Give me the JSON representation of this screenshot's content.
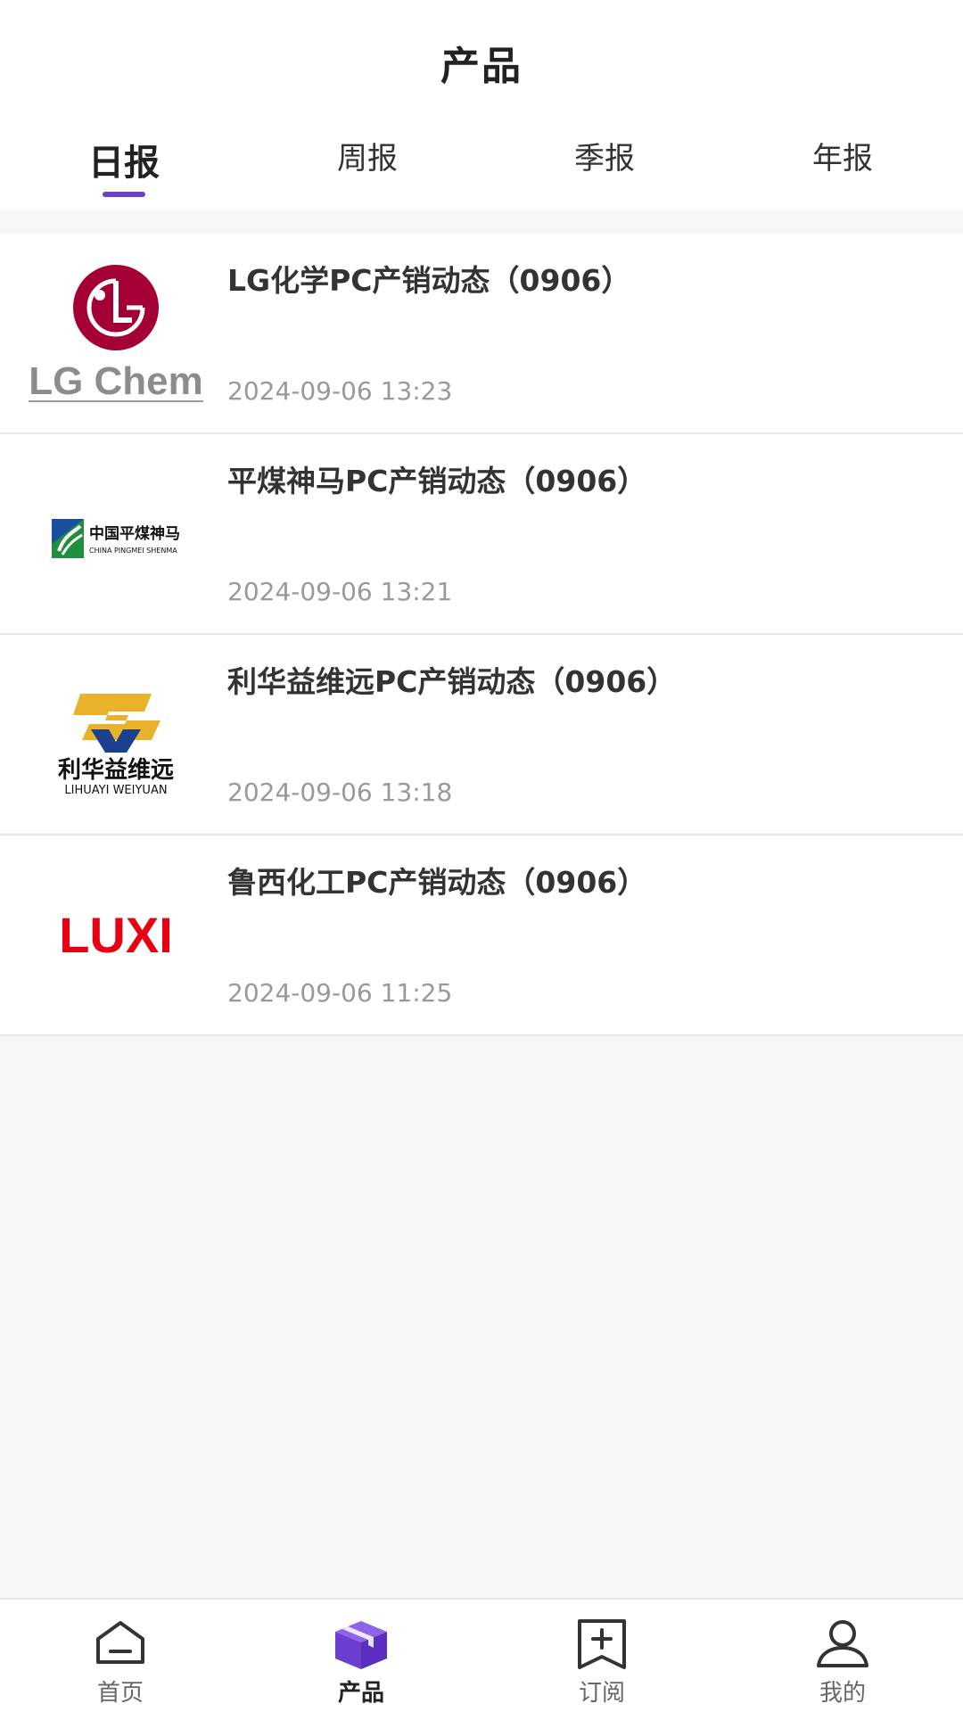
{
  "header": {
    "title": "产品"
  },
  "tabs": [
    {
      "label": "日报",
      "active": true
    },
    {
      "label": "周报",
      "active": false
    },
    {
      "label": "季报",
      "active": false
    },
    {
      "label": "年报",
      "active": false
    }
  ],
  "colors": {
    "accent": "#6a3fd0",
    "lg_red": "#a50034",
    "luxi_red": "#e60012",
    "pingmei_green": "#1f8e3d",
    "pingmei_blue": "#1a4fa0",
    "lihua_gold": "#e8b32a",
    "lihua_blue": "#1c3f8f"
  },
  "items": [
    {
      "logo": "lg-chem-logo",
      "logo_text": "LG Chem",
      "title": "LG化学PC产销动态（0906）",
      "time": "2024-09-06 13:23"
    },
    {
      "logo": "pingmei-shenma-logo",
      "logo_text_cn": "中国平煤神马",
      "logo_text_en": "CHINA PINGMEI SHENMA",
      "title": "平煤神马PC产销动态（0906）",
      "time": "2024-09-06 13:21"
    },
    {
      "logo": "lihuayi-weiyuan-logo",
      "logo_text_cn": "利华益维远",
      "logo_text_en": "LIHUAYI WEIYUAN",
      "title": "利华益维远PC产销动态（0906）",
      "time": "2024-09-06 13:18"
    },
    {
      "logo": "luxi-logo",
      "logo_text": "LUXI",
      "title": "鲁西化工PC产销动态（0906）",
      "time": "2024-09-06 11:25"
    }
  ],
  "nav": [
    {
      "label": "首页",
      "icon": "home-icon",
      "active": false
    },
    {
      "label": "产品",
      "icon": "box-icon",
      "active": true
    },
    {
      "label": "订阅",
      "icon": "subscribe-icon",
      "active": false
    },
    {
      "label": "我的",
      "icon": "user-icon",
      "active": false
    }
  ]
}
